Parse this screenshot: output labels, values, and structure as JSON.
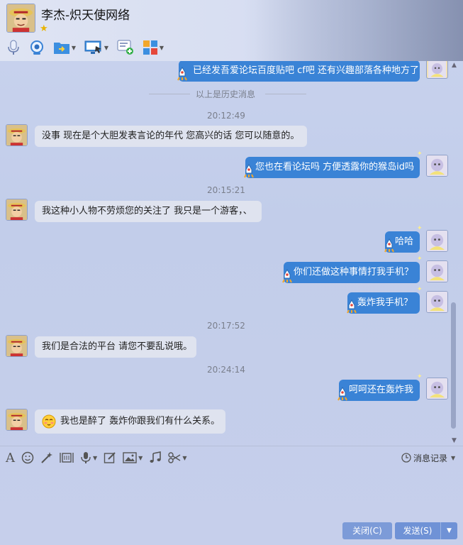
{
  "header": {
    "contact_name": "李杰-炽天使网络",
    "vip_icon": "star-icon"
  },
  "toolbar": {
    "items": [
      "voice-call-icon",
      "video-call-icon",
      "file-transfer-icon",
      "screen-share-icon",
      "add-message-icon",
      "apps-icon"
    ]
  },
  "chat": {
    "history_label": "以上是历史消息",
    "messages": [
      {
        "dir": "out",
        "text": "已经发吾爱论坛百度贴吧 cf吧 还有兴趣部落各种地方了"
      },
      {
        "dir": "time",
        "text": "20:12:49"
      },
      {
        "dir": "in",
        "text": "没事 现在是个大胆发表言论的年代  您高兴的话 您可以随意的。"
      },
      {
        "dir": "out",
        "text": "您也在看论坛吗 方便透露你的猴岛id吗"
      },
      {
        "dir": "time",
        "text": "20:15:21"
      },
      {
        "dir": "in",
        "text": "我这种小人物不劳烦您的关注了 我只是一个游客，、"
      },
      {
        "dir": "out",
        "text": "哈哈"
      },
      {
        "dir": "out",
        "text": "你们还做这种事情打我手机？"
      },
      {
        "dir": "out",
        "text": "轰炸我手机？"
      },
      {
        "dir": "time",
        "text": "20:17:52"
      },
      {
        "dir": "in",
        "text": "我们是合法的平台 请您不要乱说哦。"
      },
      {
        "dir": "time",
        "text": "20:24:14"
      },
      {
        "dir": "out",
        "text": "呵呵还在轰炸我"
      },
      {
        "dir": "in",
        "text": "我也是醉了 轰炸你跟我们有什么关系。",
        "emoji": "blush-emoji-icon"
      }
    ]
  },
  "input_toolbar": {
    "items": [
      "font-icon",
      "emoji-icon",
      "magic-icon",
      "screen-capture-icon",
      "voice-message-icon",
      "edit-icon",
      "image-icon",
      "music-icon",
      "scissors-icon"
    ],
    "history_label": "消息记录"
  },
  "buttons": {
    "close_label": "关闭(C)",
    "send_label": "发送(S)"
  },
  "colors": {
    "outgoing_bubble": "#3a83d6",
    "incoming_bubble": "#dfe3ef",
    "background": "#c6cfeb",
    "button": "#7c9bd8"
  }
}
